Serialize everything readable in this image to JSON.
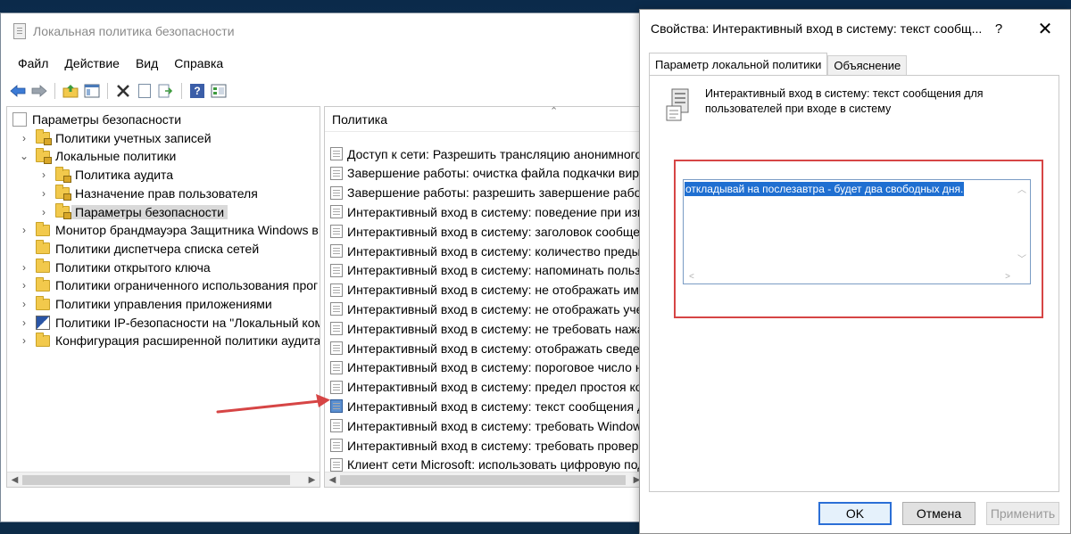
{
  "main_window": {
    "title": "Локальная политика безопасности",
    "menu": [
      "Файл",
      "Действие",
      "Вид",
      "Справка"
    ]
  },
  "toolbar_icons": [
    "back-arrow-icon",
    "forward-arrow-icon",
    "up-folder-icon",
    "show-tree-icon",
    "delete-icon",
    "properties-icon",
    "export-icon",
    "help-icon",
    "view-icon"
  ],
  "tree": {
    "items": [
      {
        "label": "Параметры безопасности",
        "level": 0,
        "expander": "",
        "icon": "root"
      },
      {
        "label": "Политики учетных записей",
        "level": 1,
        "expander": "closed",
        "icon": "folder-locked"
      },
      {
        "label": "Локальные политики",
        "level": 1,
        "expander": "open",
        "icon": "folder-locked"
      },
      {
        "label": "Политика аудита",
        "level": 2,
        "expander": "closed",
        "icon": "folder-locked"
      },
      {
        "label": "Назначение прав пользователя",
        "level": 2,
        "expander": "closed",
        "icon": "folder-locked"
      },
      {
        "label": "Параметры безопасности",
        "level": 2,
        "expander": "closed",
        "icon": "folder-locked",
        "selected": true
      },
      {
        "label": "Монитор брандмауэра Защитника Windows в р",
        "level": 1,
        "expander": "closed",
        "icon": "folder"
      },
      {
        "label": "Политики диспетчера списка сетей",
        "level": 1,
        "expander": "",
        "icon": "folder"
      },
      {
        "label": "Политики открытого ключа",
        "level": 1,
        "expander": "closed",
        "icon": "folder"
      },
      {
        "label": "Политики ограниченного использования прог",
        "level": 1,
        "expander": "closed",
        "icon": "folder"
      },
      {
        "label": "Политики управления приложениями",
        "level": 1,
        "expander": "closed",
        "icon": "folder"
      },
      {
        "label": "Политики IP-безопасности на \"Локальный ком",
        "level": 1,
        "expander": "closed",
        "icon": "shield"
      },
      {
        "label": "Конфигурация расширенной политики аудита",
        "level": 1,
        "expander": "closed",
        "icon": "folder"
      }
    ]
  },
  "policy_list": {
    "header": "Политика",
    "items": [
      "Доступ к сети: Разрешить трансляцию анонимного",
      "Завершение работы: очистка файла подкачки вирт",
      "Завершение работы: разрешить завершение работ",
      "Интерактивный вход в систему:  поведение при изв",
      "Интерактивный вход в систему: заголовок сообщен",
      "Интерактивный вход в систему: количество предыд",
      "Интерактивный вход в систему: напоминать пользо",
      "Интерактивный вход в систему: не отображать имя",
      "Интерактивный вход в систему: не отображать учет",
      "Интерактивный вход в систему: не требовать нажат",
      "Интерактивный вход в систему: отображать сведен",
      "Интерактивный вход в систему: пороговое число не",
      "Интерактивный вход в систему: предел простоя ком",
      "Интерактивный вход в систему: текст сообщения дл",
      "Интерактивный вход в систему: требовать Windows",
      "Интерактивный вход в систему: требовать проверки",
      "Клиент сети Microsoft: использовать цифровую под"
    ],
    "selected_index": 13
  },
  "dialog": {
    "title": "Свойства: Интерактивный вход в систему: текст сообщ...",
    "help": "?",
    "close": "✕",
    "tabs": [
      "Параметр локальной политики",
      "Объяснение"
    ],
    "active_tab": 0,
    "policy_description": "Интерактивный вход в систему: текст сообщения для пользователей при входе в систему",
    "text_value": "откладывай на послезавтра - будет два свободных дня.",
    "buttons": {
      "ok": "OK",
      "cancel": "Отмена",
      "apply": "Применить"
    }
  },
  "colors": {
    "selection_blue": "#1f6fd1",
    "annotation_red": "#d64545",
    "default_button_border": "#2b6fd6"
  }
}
